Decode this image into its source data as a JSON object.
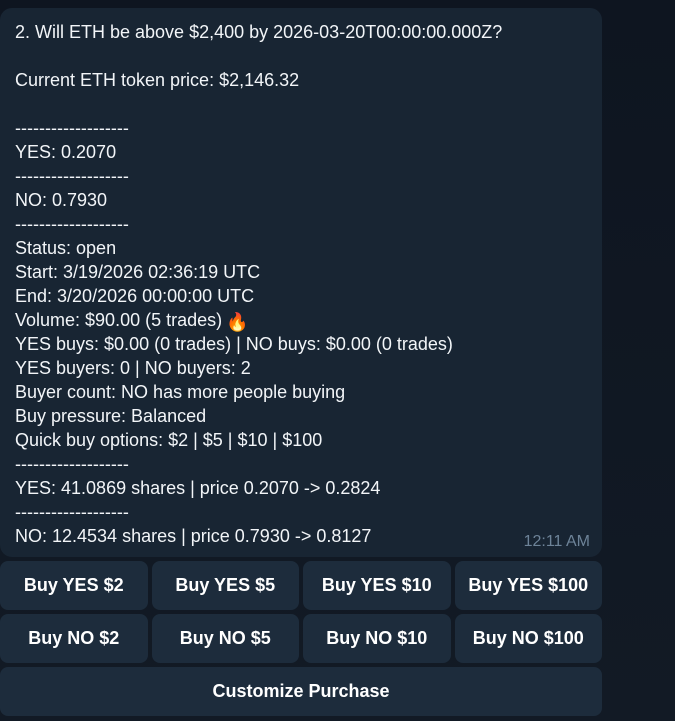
{
  "message": {
    "lines": [
      "2. Will ETH be above $2,400 by 2026-03-20T00:00:00.000Z?",
      "",
      "Current ETH token price: $2,146.32",
      "",
      "-------------------",
      "YES: 0.2070",
      "-------------------",
      "NO: 0.7930",
      "-------------------",
      "Status: open",
      "Start: 3/19/2026 02:36:19 UTC",
      "End: 3/20/2026 00:00:00 UTC",
      "Volume: $90.00 (5 trades)",
      "YES buys: $0.00 (0 trades) | NO buys: $0.00 (0 trades)",
      "YES buyers: 0 | NO buyers: 2",
      "Buyer count: NO has more people buying",
      "Buy pressure: Balanced",
      "Quick buy options: $2 | $5 | $10 | $100",
      "-------------------",
      "YES: 41.0869 shares | price 0.2070 -> 0.2824",
      "-------------------",
      "NO: 12.4534 shares | price 0.7930 -> 0.8127"
    ],
    "volume_emoji": "🔥",
    "time": "12:11 AM"
  },
  "keyboard": {
    "row1": [
      "Buy YES $2",
      "Buy YES $5",
      "Buy YES $10",
      "Buy YES $100"
    ],
    "row2": [
      "Buy NO $2",
      "Buy NO $5",
      "Buy NO $10",
      "Buy NO $100"
    ],
    "customize": "Customize Purchase"
  }
}
